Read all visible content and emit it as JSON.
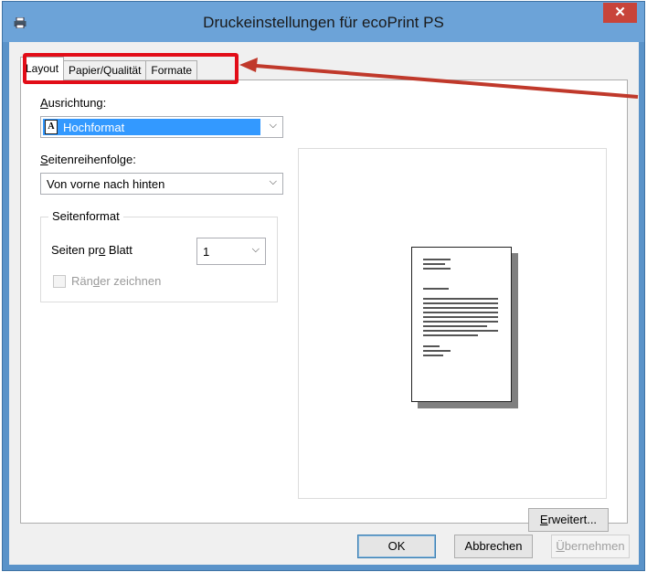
{
  "window": {
    "title": "Druckeinstellungen für ecoPrint PS",
    "close_glyph": "✕",
    "icon": "printer-icon"
  },
  "tabs": [
    {
      "label": "Layout",
      "active": true
    },
    {
      "label": "Papier/Qualität",
      "active": false
    },
    {
      "label": "Formate",
      "active": false
    }
  ],
  "layout": {
    "orientation": {
      "label_accel": "A",
      "label_rest": "usrichtung:",
      "value": "Hochformat",
      "icon_glyph": "A"
    },
    "page_order": {
      "label_accel": "S",
      "label_rest": "eitenreihenfolge:",
      "value": "Von vorne nach hinten"
    },
    "page_format": {
      "legend": "Seitenformat",
      "pages_per_sheet_pre": "Seiten pr",
      "pages_per_sheet_accel": "o",
      "pages_per_sheet_post": " Blatt",
      "pages_per_sheet_value": "1",
      "draw_borders_pre": "Rän",
      "draw_borders_accel": "d",
      "draw_borders_post": "er zeichnen",
      "draw_borders_checked": false
    },
    "advanced_pre": "",
    "advanced_accel": "E",
    "advanced_post": "rweitert..."
  },
  "buttons": {
    "ok": "OK",
    "cancel": "Abbrechen",
    "apply_accel": "Ü",
    "apply_rest": "bernehmen"
  },
  "colors": {
    "title_bar": "#6ca3d8",
    "close_button": "#c8443a",
    "highlight": "#e20d18",
    "selection": "#3399ff"
  }
}
